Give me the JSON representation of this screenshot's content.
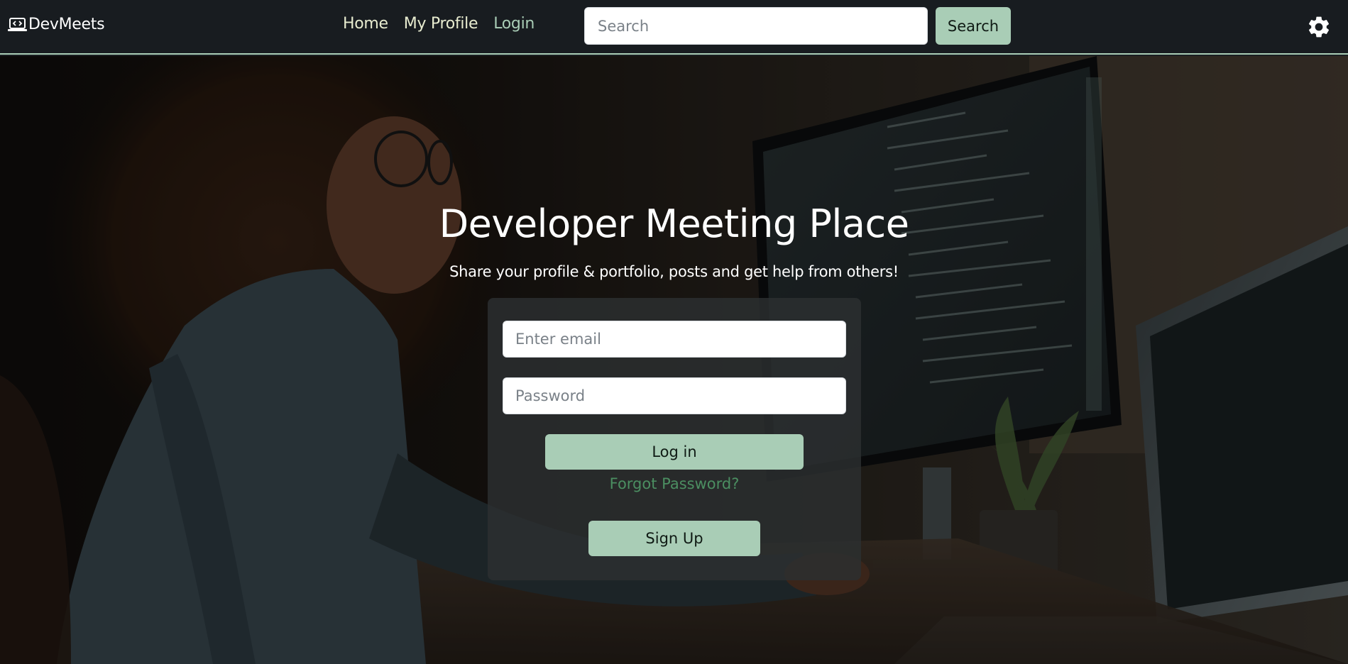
{
  "navbar": {
    "brand": "DevMeets",
    "links": [
      {
        "label": "Home",
        "active": false
      },
      {
        "label": "My Profile",
        "active": false
      },
      {
        "label": "Login",
        "active": true
      }
    ],
    "search": {
      "placeholder": "Search",
      "value": "",
      "button_label": "Search"
    },
    "settings_icon": "gear-icon"
  },
  "hero": {
    "title": "Developer Meeting Place",
    "subtitle": "Share your profile & portfolio, posts and get help from others!"
  },
  "login_form": {
    "email_placeholder": "Enter email",
    "password_placeholder": "Password",
    "login_label": "Log in",
    "forgot_label": "Forgot Password?",
    "signup_label": "Sign Up"
  },
  "colors": {
    "navbar_bg": "#181c20",
    "accent": "#a9cdb6",
    "forgot_link": "#4b8e61"
  }
}
